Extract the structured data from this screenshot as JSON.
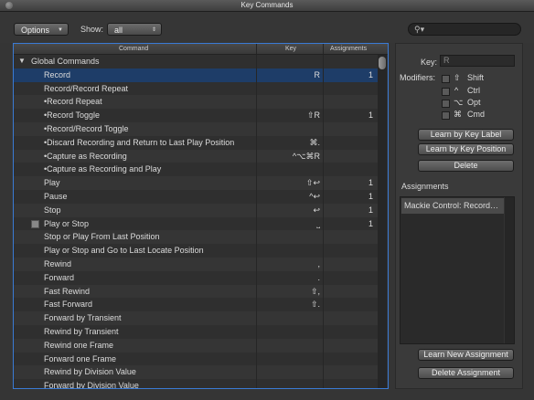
{
  "window": {
    "title": "Key Commands"
  },
  "toolbar": {
    "options_label": "Options",
    "show_label": "Show:",
    "show_value": "all",
    "search_placeholder": ""
  },
  "columns": {
    "command": "Command",
    "key": "Key",
    "assignments": "Assignments"
  },
  "rows": [
    {
      "name": "Global Commands",
      "key": "",
      "asg": "",
      "group": true
    },
    {
      "name": "Record",
      "key": "R",
      "asg": "1",
      "selected": true
    },
    {
      "name": "Record/Record Repeat",
      "key": "",
      "asg": ""
    },
    {
      "name": "•Record Repeat",
      "key": "",
      "asg": ""
    },
    {
      "name": "•Record Toggle",
      "key": "⇧R",
      "asg": "1"
    },
    {
      "name": "•Record/Record Toggle",
      "key": "",
      "asg": ""
    },
    {
      "name": "•Discard Recording and Return to Last Play Position",
      "key": "⌘.",
      "asg": ""
    },
    {
      "name": "•Capture as Recording",
      "key": "^⌥⌘R",
      "asg": ""
    },
    {
      "name": "•Capture as Recording and Play",
      "key": "",
      "asg": ""
    },
    {
      "name": "Play",
      "key": "⇧↩",
      "asg": "1"
    },
    {
      "name": "Pause",
      "key": "^↩",
      "asg": "1"
    },
    {
      "name": "Stop",
      "key": "↩",
      "asg": "1"
    },
    {
      "name": "Play or Stop",
      "key": "⎵",
      "asg": "1",
      "icon": true
    },
    {
      "name": "Stop or Play From Last Position",
      "key": "",
      "asg": ""
    },
    {
      "name": "Play or Stop and Go to Last Locate Position",
      "key": "",
      "asg": ""
    },
    {
      "name": "Rewind",
      "key": ",",
      "asg": ""
    },
    {
      "name": "Forward",
      "key": ".",
      "asg": ""
    },
    {
      "name": "Fast Rewind",
      "key": "⇧,",
      "asg": ""
    },
    {
      "name": "Fast Forward",
      "key": "⇧.",
      "asg": ""
    },
    {
      "name": "Forward by Transient",
      "key": "",
      "asg": ""
    },
    {
      "name": "Rewind by Transient",
      "key": "",
      "asg": ""
    },
    {
      "name": "Rewind one Frame",
      "key": "",
      "asg": ""
    },
    {
      "name": "Forward one Frame",
      "key": "",
      "asg": ""
    },
    {
      "name": "Rewind by Division Value",
      "key": "",
      "asg": ""
    },
    {
      "name": "Forward by Division Value",
      "key": "",
      "asg": ""
    }
  ],
  "right_panel": {
    "key_label": "Key:",
    "key_value": "R",
    "modifiers_label": "Modifiers:",
    "modifiers": [
      {
        "symbol": "⇧",
        "name": "Shift"
      },
      {
        "symbol": "^",
        "name": "Ctrl"
      },
      {
        "symbol": "⌥",
        "name": "Opt"
      },
      {
        "symbol": "⌘",
        "name": "Cmd"
      }
    ],
    "learn_label": "Learn by Key Label",
    "learn_position": "Learn by Key Position",
    "delete": "Delete",
    "assignments_title": "Assignments",
    "assignment_item": "Mackie Control: Record…",
    "learn_new": "Learn New Assignment",
    "delete_assignment": "Delete Assignment"
  },
  "colors": {
    "selection": "#1e3d68",
    "focus": "#3a7bd5",
    "background": "#353535"
  },
  "icons": {
    "search": "search-icon",
    "disclosure": "disclosure-triangle-icon",
    "close": "close-icon"
  }
}
